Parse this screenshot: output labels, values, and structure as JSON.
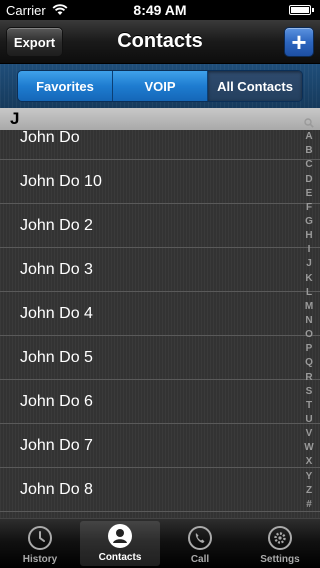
{
  "status_bar": {
    "carrier": "Carrier",
    "time": "8:49 AM"
  },
  "nav_bar": {
    "title": "Contacts",
    "export_label": "Export",
    "add_label": "+"
  },
  "segments": [
    {
      "label": "Favorites",
      "selected": false
    },
    {
      "label": "VOIP",
      "selected": false
    },
    {
      "label": "All Contacts",
      "selected": true
    }
  ],
  "section": {
    "header": "J"
  },
  "contacts": [
    "John Do",
    "John Do 10",
    "John Do 2",
    "John Do 3",
    "John Do 4",
    "John Do 5",
    "John Do 6",
    "John Do 7",
    "John Do 8"
  ],
  "index_letters": [
    "A",
    "B",
    "C",
    "D",
    "E",
    "F",
    "G",
    "H",
    "I",
    "J",
    "K",
    "L",
    "M",
    "N",
    "O",
    "P",
    "Q",
    "R",
    "S",
    "T",
    "U",
    "V",
    "W",
    "X",
    "Y",
    "Z",
    "#"
  ],
  "tabs": [
    {
      "label": "History",
      "icon": "clock-icon",
      "selected": false
    },
    {
      "label": "Contacts",
      "icon": "person-icon",
      "selected": true
    },
    {
      "label": "Call",
      "icon": "phone-icon",
      "selected": false
    },
    {
      "label": "Settings",
      "icon": "gear-icon",
      "selected": false
    }
  ],
  "colors": {
    "accent": "#1e7cd0",
    "add_button": "#2d66bf"
  }
}
